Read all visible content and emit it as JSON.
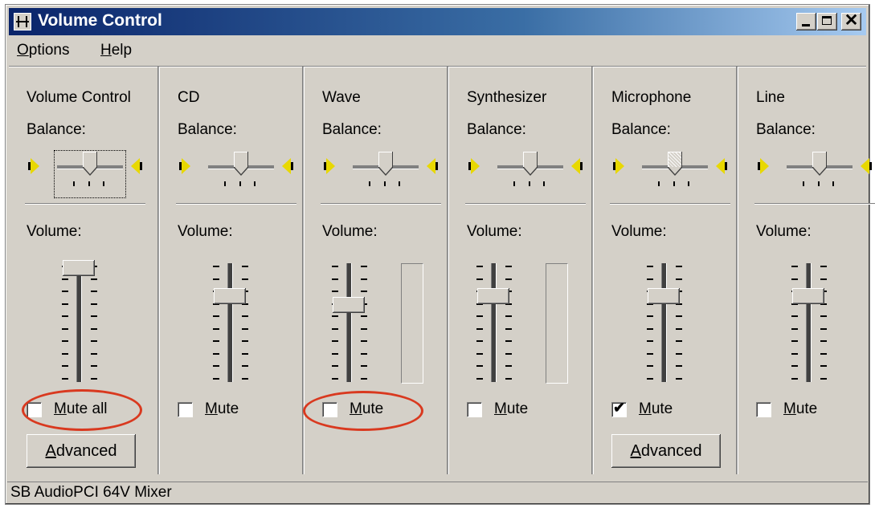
{
  "window": {
    "title": "Volume Control",
    "buttons": {
      "minimize": "minimize-icon",
      "maximize": "maximize-icon",
      "close": "✕"
    }
  },
  "menu": [
    {
      "label_first": "O",
      "label_rest": "ptions"
    },
    {
      "label_first": "H",
      "label_rest": "elp"
    }
  ],
  "channels": [
    {
      "name": "Volume Control",
      "balance_label": "Balance:",
      "volume_label": "Volume:",
      "volume_level": 1.0,
      "has_peak_meter": false,
      "mute_first": "M",
      "mute_rest": "ute all",
      "muted": false,
      "advanced_first": "A",
      "advanced_rest": "dvanced",
      "has_advanced": true
    },
    {
      "name": "CD",
      "balance_label": "Balance:",
      "volume_label": "Volume:",
      "volume_level": 0.75,
      "has_peak_meter": false,
      "mute_first": "M",
      "mute_rest": "ute",
      "muted": false,
      "has_advanced": false
    },
    {
      "name": "Wave",
      "balance_label": "Balance:",
      "volume_label": "Volume:",
      "volume_level": 0.67,
      "has_peak_meter": true,
      "mute_first": "M",
      "mute_rest": "ute",
      "muted": false,
      "has_advanced": false
    },
    {
      "name": "Synthesizer",
      "balance_label": "Balance:",
      "volume_label": "Volume:",
      "volume_level": 0.75,
      "has_peak_meter": true,
      "mute_first": "M",
      "mute_rest": "ute",
      "muted": false,
      "has_advanced": false
    },
    {
      "name": "Microphone",
      "balance_label": "Balance:",
      "volume_label": "Volume:",
      "volume_level": 0.75,
      "has_peak_meter": false,
      "mute_first": "M",
      "mute_rest": "ute",
      "muted": true,
      "advanced_first": "A",
      "advanced_rest": "dvanced",
      "has_advanced": true
    },
    {
      "name": "Line",
      "balance_label": "Balance:",
      "volume_label": "Volume:",
      "volume_level": 0.75,
      "has_peak_meter": false,
      "mute_first": "M",
      "mute_rest": "ute",
      "muted": false,
      "has_advanced": false
    }
  ],
  "status_bar": "SB AudioPCI 64V Mixer",
  "colors": {
    "title_start": "#0a246a",
    "title_end": "#a6caf0",
    "face": "#d4d0c8",
    "annotation": "#d9391f",
    "speaker": "#e8d800"
  }
}
